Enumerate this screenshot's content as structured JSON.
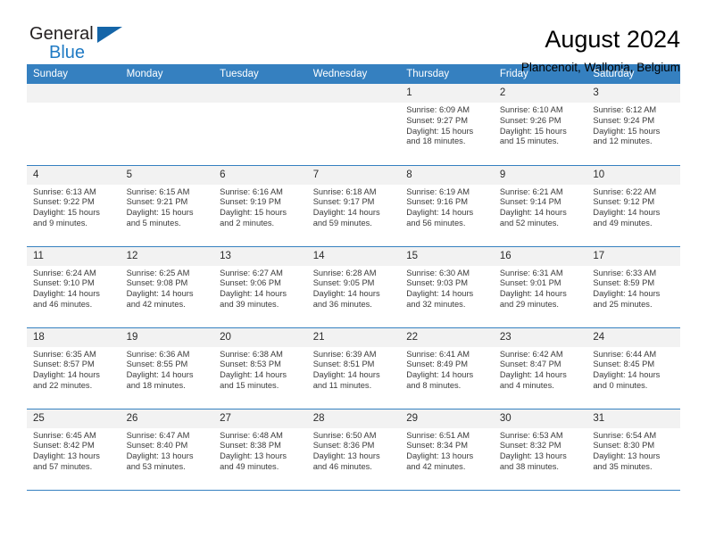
{
  "brand": {
    "name_part1": "General",
    "name_part2": "Blue"
  },
  "header": {
    "title": "August 2024",
    "location": "Plancenoit, Wallonia, Belgium"
  },
  "weekday_headers": [
    "Sunday",
    "Monday",
    "Tuesday",
    "Wednesday",
    "Thursday",
    "Friday",
    "Saturday"
  ],
  "colors": {
    "header_blue": "#3580c0",
    "brand_blue": "#1f7ac4",
    "daynum_band": "#f2f2f2"
  },
  "weeks": [
    [
      {
        "day": "",
        "sunrise": "",
        "sunset": "",
        "daylight1": "",
        "daylight2": ""
      },
      {
        "day": "",
        "sunrise": "",
        "sunset": "",
        "daylight1": "",
        "daylight2": ""
      },
      {
        "day": "",
        "sunrise": "",
        "sunset": "",
        "daylight1": "",
        "daylight2": ""
      },
      {
        "day": "",
        "sunrise": "",
        "sunset": "",
        "daylight1": "",
        "daylight2": ""
      },
      {
        "day": "1",
        "sunrise": "Sunrise: 6:09 AM",
        "sunset": "Sunset: 9:27 PM",
        "daylight1": "Daylight: 15 hours",
        "daylight2": "and 18 minutes."
      },
      {
        "day": "2",
        "sunrise": "Sunrise: 6:10 AM",
        "sunset": "Sunset: 9:26 PM",
        "daylight1": "Daylight: 15 hours",
        "daylight2": "and 15 minutes."
      },
      {
        "day": "3",
        "sunrise": "Sunrise: 6:12 AM",
        "sunset": "Sunset: 9:24 PM",
        "daylight1": "Daylight: 15 hours",
        "daylight2": "and 12 minutes."
      }
    ],
    [
      {
        "day": "4",
        "sunrise": "Sunrise: 6:13 AM",
        "sunset": "Sunset: 9:22 PM",
        "daylight1": "Daylight: 15 hours",
        "daylight2": "and 9 minutes."
      },
      {
        "day": "5",
        "sunrise": "Sunrise: 6:15 AM",
        "sunset": "Sunset: 9:21 PM",
        "daylight1": "Daylight: 15 hours",
        "daylight2": "and 5 minutes."
      },
      {
        "day": "6",
        "sunrise": "Sunrise: 6:16 AM",
        "sunset": "Sunset: 9:19 PM",
        "daylight1": "Daylight: 15 hours",
        "daylight2": "and 2 minutes."
      },
      {
        "day": "7",
        "sunrise": "Sunrise: 6:18 AM",
        "sunset": "Sunset: 9:17 PM",
        "daylight1": "Daylight: 14 hours",
        "daylight2": "and 59 minutes."
      },
      {
        "day": "8",
        "sunrise": "Sunrise: 6:19 AM",
        "sunset": "Sunset: 9:16 PM",
        "daylight1": "Daylight: 14 hours",
        "daylight2": "and 56 minutes."
      },
      {
        "day": "9",
        "sunrise": "Sunrise: 6:21 AM",
        "sunset": "Sunset: 9:14 PM",
        "daylight1": "Daylight: 14 hours",
        "daylight2": "and 52 minutes."
      },
      {
        "day": "10",
        "sunrise": "Sunrise: 6:22 AM",
        "sunset": "Sunset: 9:12 PM",
        "daylight1": "Daylight: 14 hours",
        "daylight2": "and 49 minutes."
      }
    ],
    [
      {
        "day": "11",
        "sunrise": "Sunrise: 6:24 AM",
        "sunset": "Sunset: 9:10 PM",
        "daylight1": "Daylight: 14 hours",
        "daylight2": "and 46 minutes."
      },
      {
        "day": "12",
        "sunrise": "Sunrise: 6:25 AM",
        "sunset": "Sunset: 9:08 PM",
        "daylight1": "Daylight: 14 hours",
        "daylight2": "and 42 minutes."
      },
      {
        "day": "13",
        "sunrise": "Sunrise: 6:27 AM",
        "sunset": "Sunset: 9:06 PM",
        "daylight1": "Daylight: 14 hours",
        "daylight2": "and 39 minutes."
      },
      {
        "day": "14",
        "sunrise": "Sunrise: 6:28 AM",
        "sunset": "Sunset: 9:05 PM",
        "daylight1": "Daylight: 14 hours",
        "daylight2": "and 36 minutes."
      },
      {
        "day": "15",
        "sunrise": "Sunrise: 6:30 AM",
        "sunset": "Sunset: 9:03 PM",
        "daylight1": "Daylight: 14 hours",
        "daylight2": "and 32 minutes."
      },
      {
        "day": "16",
        "sunrise": "Sunrise: 6:31 AM",
        "sunset": "Sunset: 9:01 PM",
        "daylight1": "Daylight: 14 hours",
        "daylight2": "and 29 minutes."
      },
      {
        "day": "17",
        "sunrise": "Sunrise: 6:33 AM",
        "sunset": "Sunset: 8:59 PM",
        "daylight1": "Daylight: 14 hours",
        "daylight2": "and 25 minutes."
      }
    ],
    [
      {
        "day": "18",
        "sunrise": "Sunrise: 6:35 AM",
        "sunset": "Sunset: 8:57 PM",
        "daylight1": "Daylight: 14 hours",
        "daylight2": "and 22 minutes."
      },
      {
        "day": "19",
        "sunrise": "Sunrise: 6:36 AM",
        "sunset": "Sunset: 8:55 PM",
        "daylight1": "Daylight: 14 hours",
        "daylight2": "and 18 minutes."
      },
      {
        "day": "20",
        "sunrise": "Sunrise: 6:38 AM",
        "sunset": "Sunset: 8:53 PM",
        "daylight1": "Daylight: 14 hours",
        "daylight2": "and 15 minutes."
      },
      {
        "day": "21",
        "sunrise": "Sunrise: 6:39 AM",
        "sunset": "Sunset: 8:51 PM",
        "daylight1": "Daylight: 14 hours",
        "daylight2": "and 11 minutes."
      },
      {
        "day": "22",
        "sunrise": "Sunrise: 6:41 AM",
        "sunset": "Sunset: 8:49 PM",
        "daylight1": "Daylight: 14 hours",
        "daylight2": "and 8 minutes."
      },
      {
        "day": "23",
        "sunrise": "Sunrise: 6:42 AM",
        "sunset": "Sunset: 8:47 PM",
        "daylight1": "Daylight: 14 hours",
        "daylight2": "and 4 minutes."
      },
      {
        "day": "24",
        "sunrise": "Sunrise: 6:44 AM",
        "sunset": "Sunset: 8:45 PM",
        "daylight1": "Daylight: 14 hours",
        "daylight2": "and 0 minutes."
      }
    ],
    [
      {
        "day": "25",
        "sunrise": "Sunrise: 6:45 AM",
        "sunset": "Sunset: 8:42 PM",
        "daylight1": "Daylight: 13 hours",
        "daylight2": "and 57 minutes."
      },
      {
        "day": "26",
        "sunrise": "Sunrise: 6:47 AM",
        "sunset": "Sunset: 8:40 PM",
        "daylight1": "Daylight: 13 hours",
        "daylight2": "and 53 minutes."
      },
      {
        "day": "27",
        "sunrise": "Sunrise: 6:48 AM",
        "sunset": "Sunset: 8:38 PM",
        "daylight1": "Daylight: 13 hours",
        "daylight2": "and 49 minutes."
      },
      {
        "day": "28",
        "sunrise": "Sunrise: 6:50 AM",
        "sunset": "Sunset: 8:36 PM",
        "daylight1": "Daylight: 13 hours",
        "daylight2": "and 46 minutes."
      },
      {
        "day": "29",
        "sunrise": "Sunrise: 6:51 AM",
        "sunset": "Sunset: 8:34 PM",
        "daylight1": "Daylight: 13 hours",
        "daylight2": "and 42 minutes."
      },
      {
        "day": "30",
        "sunrise": "Sunrise: 6:53 AM",
        "sunset": "Sunset: 8:32 PM",
        "daylight1": "Daylight: 13 hours",
        "daylight2": "and 38 minutes."
      },
      {
        "day": "31",
        "sunrise": "Sunrise: 6:54 AM",
        "sunset": "Sunset: 8:30 PM",
        "daylight1": "Daylight: 13 hours",
        "daylight2": "and 35 minutes."
      }
    ]
  ]
}
